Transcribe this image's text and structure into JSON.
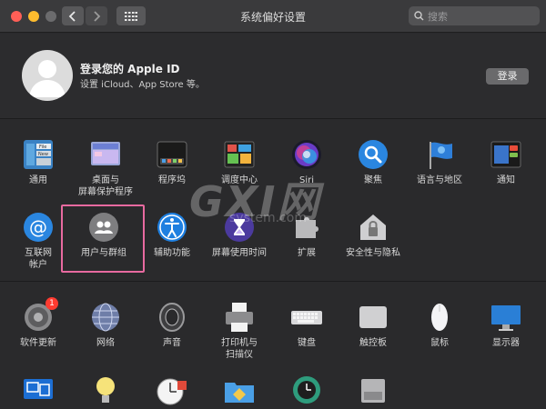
{
  "window": {
    "title": "系统偏好设置"
  },
  "search": {
    "placeholder": "搜索"
  },
  "account": {
    "title": "登录您的 Apple ID",
    "subtitle": "设置 iCloud、App Store 等。",
    "login_label": "登录"
  },
  "section1": {
    "row1": [
      {
        "label": "通用",
        "icon": "general-icon"
      },
      {
        "label": "桌面与\n屏幕保护程序",
        "icon": "desktop-icon"
      },
      {
        "label": "程序坞",
        "icon": "dock-icon"
      },
      {
        "label": "调度中心",
        "icon": "mission-control-icon"
      },
      {
        "label": "Siri",
        "icon": "siri-icon"
      },
      {
        "label": "聚焦",
        "icon": "spotlight-icon"
      },
      {
        "label": "语言与地区",
        "icon": "language-icon"
      },
      {
        "label": "通知",
        "icon": "notifications-icon"
      }
    ],
    "row2": [
      {
        "label": "互联网\n帐户",
        "icon": "internet-accounts-icon"
      },
      {
        "label": "用户与群组",
        "icon": "users-groups-icon"
      },
      {
        "label": "辅助功能",
        "icon": "accessibility-icon"
      },
      {
        "label": "屏幕使用时间",
        "icon": "screen-time-icon"
      },
      {
        "label": "扩展",
        "icon": "extensions-icon"
      },
      {
        "label": "安全性与隐私",
        "icon": "security-icon"
      }
    ]
  },
  "section2": {
    "row1": [
      {
        "label": "软件更新",
        "icon": "software-update-icon",
        "badge": "1"
      },
      {
        "label": "网络",
        "icon": "network-icon"
      },
      {
        "label": "声音",
        "icon": "sound-icon"
      },
      {
        "label": "打印机与\n扫描仪",
        "icon": "printer-icon"
      },
      {
        "label": "键盘",
        "icon": "keyboard-icon"
      },
      {
        "label": "触控板",
        "icon": "trackpad-icon"
      },
      {
        "label": "鼠标",
        "icon": "mouse-icon"
      },
      {
        "label": "显示器",
        "icon": "display-icon"
      }
    ],
    "row2": [
      {
        "label": "",
        "icon": "sidecar-icon"
      },
      {
        "label": "",
        "icon": "energy-saver-icon"
      },
      {
        "label": "",
        "icon": "date-time-icon"
      },
      {
        "label": "",
        "icon": "sharing-icon"
      },
      {
        "label": "",
        "icon": "time-machine-icon"
      },
      {
        "label": "",
        "icon": "startup-disk-icon"
      }
    ]
  },
  "watermark": {
    "text": "GXI网",
    "subtext": "system.com"
  },
  "colors": {
    "highlight": "#e86aa0",
    "badge": "#ff3b30",
    "window_bg": "#2a2a2c"
  }
}
